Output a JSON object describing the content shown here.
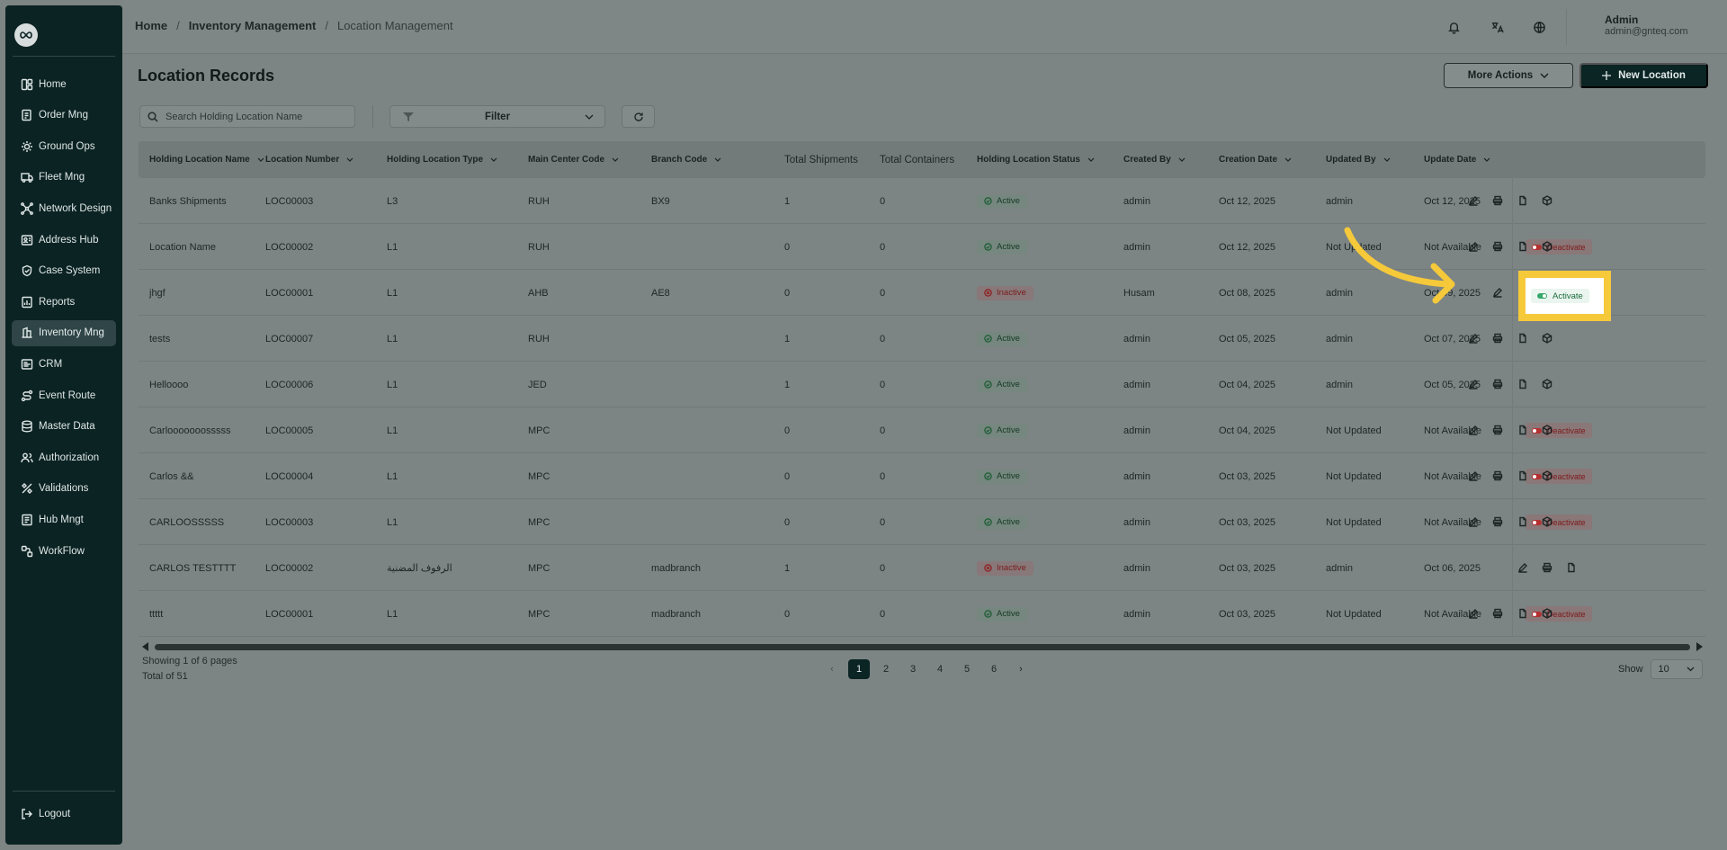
{
  "sidebar": {
    "items": [
      {
        "label": "Home",
        "icon": "home-grid-icon"
      },
      {
        "label": "Order Mng",
        "icon": "order-icon"
      },
      {
        "label": "Ground Ops",
        "icon": "ground-ops-icon"
      },
      {
        "label": "Fleet Mng",
        "icon": "truck-icon"
      },
      {
        "label": "Network Design",
        "icon": "network-icon"
      },
      {
        "label": "Address Hub",
        "icon": "address-icon"
      },
      {
        "label": "Case System",
        "icon": "case-icon"
      },
      {
        "label": "Reports",
        "icon": "reports-icon"
      },
      {
        "label": "Inventory Mng",
        "icon": "inventory-icon",
        "active": true
      },
      {
        "label": "CRM",
        "icon": "crm-icon"
      },
      {
        "label": "Event Route",
        "icon": "route-icon"
      },
      {
        "label": "Master Data",
        "icon": "database-icon"
      },
      {
        "label": "Authorization",
        "icon": "users-icon"
      },
      {
        "label": "Validations",
        "icon": "validations-icon"
      },
      {
        "label": "Hub Mngt",
        "icon": "hub-icon"
      },
      {
        "label": "WorkFlow",
        "icon": "workflow-icon"
      }
    ],
    "logout": "Logout"
  },
  "breadcrumb": {
    "home": "Home",
    "section": "Inventory Management",
    "current": "Location Management"
  },
  "user": {
    "name": "Admin",
    "email": "admin@gnteq.com"
  },
  "page": {
    "title": "Location Records",
    "more_actions": "More Actions",
    "new_location": "New Location",
    "search_placeholder": "Search Holding Location Name",
    "filter_label": "Filter"
  },
  "table": {
    "headers": [
      "Holding Location Name",
      "Location Number",
      "Holding Location Type",
      "Main Center Code",
      "Branch Code",
      "Total Shipments",
      "Total Containers",
      "Holding Location Status",
      "Created By",
      "Creation Date",
      "Updated By",
      "Update Date"
    ],
    "rows": [
      {
        "name": "Banks Shipments",
        "number": "LOC00003",
        "type": "L3",
        "main": "RUH",
        "branch": "BX9",
        "ship": "1",
        "cont": "0",
        "status": "Active",
        "created_by": "admin",
        "created": "Oct 12, 2025",
        "updated_by": "admin",
        "updated": "Oct 12, 2025",
        "toggle": ""
      },
      {
        "name": "Location Name",
        "number": "LOC00002",
        "type": "L1",
        "main": "RUH",
        "branch": "",
        "ship": "0",
        "cont": "0",
        "status": "Active",
        "created_by": "admin",
        "created": "Oct 12, 2025",
        "updated_by": "Not Updated",
        "updated": "Not Available",
        "toggle": "Deactivate"
      },
      {
        "name": "jhgf",
        "number": "LOC00001",
        "type": "L1",
        "main": "AHB",
        "branch": "AE8",
        "ship": "0",
        "cont": "0",
        "status": "Inactive",
        "created_by": "Husam",
        "created": "Oct 08, 2025",
        "updated_by": "admin",
        "updated": "Oct 09, 2025",
        "toggle": "Activate"
      },
      {
        "name": "tests",
        "number": "LOC00007",
        "type": "L1",
        "main": "RUH",
        "branch": "",
        "ship": "1",
        "cont": "0",
        "status": "Active",
        "created_by": "admin",
        "created": "Oct 05, 2025",
        "updated_by": "admin",
        "updated": "Oct 07, 2025",
        "toggle": ""
      },
      {
        "name": "Helloooo",
        "number": "LOC00006",
        "type": "L1",
        "main": "JED",
        "branch": "",
        "ship": "1",
        "cont": "0",
        "status": "Active",
        "created_by": "admin",
        "created": "Oct 04, 2025",
        "updated_by": "admin",
        "updated": "Oct 05, 2025",
        "toggle": ""
      },
      {
        "name": "Carlooooooosssss",
        "number": "LOC00005",
        "type": "L1",
        "main": "MPC",
        "branch": "",
        "ship": "0",
        "cont": "0",
        "status": "Active",
        "created_by": "admin",
        "created": "Oct 04, 2025",
        "updated_by": "Not Updated",
        "updated": "Not Available",
        "toggle": "Deactivate"
      },
      {
        "name": "Carlos &&",
        "number": "LOC00004",
        "type": "L1",
        "main": "MPC",
        "branch": "",
        "ship": "0",
        "cont": "0",
        "status": "Active",
        "created_by": "admin",
        "created": "Oct 03, 2025",
        "updated_by": "Not Updated",
        "updated": "Not Available",
        "toggle": "Deactivate"
      },
      {
        "name": "CARLOOSSSSS",
        "number": "LOC00003",
        "type": "L1",
        "main": "MPC",
        "branch": "",
        "ship": "0",
        "cont": "0",
        "status": "Active",
        "created_by": "admin",
        "created": "Oct 03, 2025",
        "updated_by": "Not Updated",
        "updated": "Not Available",
        "toggle": "Deactivate"
      },
      {
        "name": "CARLOS TESTTTT",
        "number": "LOC00002",
        "type": "الرفوف المضنية",
        "main": "MPC",
        "branch": "madbranch",
        "ship": "1",
        "cont": "0",
        "status": "Inactive",
        "created_by": "admin",
        "created": "Oct 03, 2025",
        "updated_by": "admin",
        "updated": "Oct 06, 2025",
        "toggle": ""
      },
      {
        "name": "ttttt",
        "number": "LOC00001",
        "type": "L1",
        "main": "MPC",
        "branch": "madbranch",
        "ship": "0",
        "cont": "0",
        "status": "Active",
        "created_by": "admin",
        "created": "Oct 03, 2025",
        "updated_by": "Not Updated",
        "updated": "Not Available",
        "toggle": "Deactivate"
      }
    ]
  },
  "highlight": {
    "label": "Activate",
    "color": "#f5c93a"
  },
  "footer": {
    "showing": "Showing 1 of 6 pages",
    "total": "Total of 51",
    "pages": [
      "1",
      "2",
      "3",
      "4",
      "5",
      "6"
    ],
    "show_label": "Show",
    "page_size": "10"
  },
  "colors": {
    "sidebar_bg": "#0b2323",
    "primary": "#0b2424",
    "active_status": "#1c5c34",
    "inactive_status": "#8e1e1e"
  }
}
